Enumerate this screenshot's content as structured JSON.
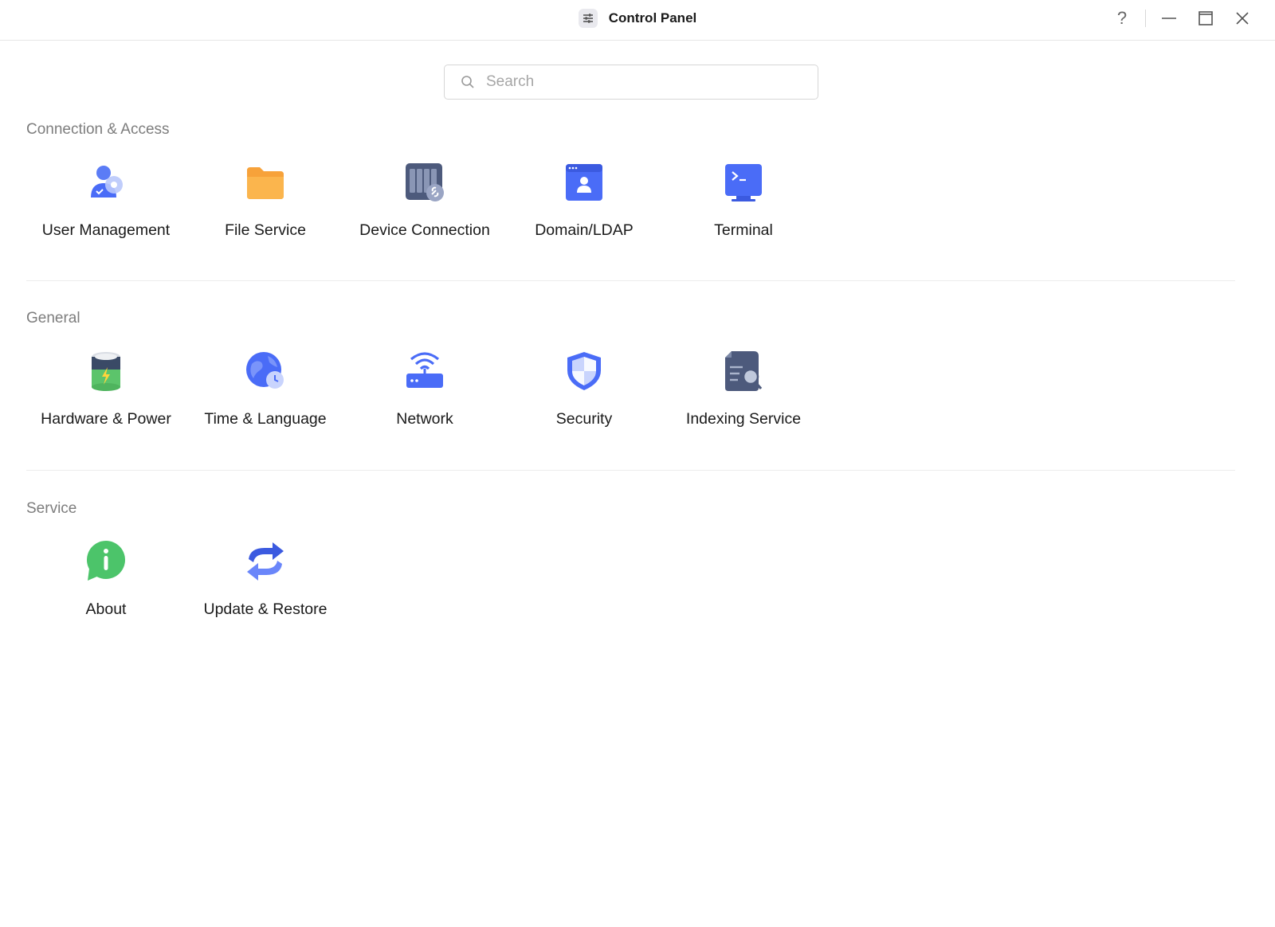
{
  "window": {
    "title": "Control Panel",
    "help_symbol": "?"
  },
  "search": {
    "placeholder": "Search",
    "value": ""
  },
  "sections": [
    {
      "title": "Connection & Access",
      "items": [
        {
          "label": "User Management",
          "icon": "user-management-icon"
        },
        {
          "label": "File Service",
          "icon": "folder-icon"
        },
        {
          "label": "Device Connection",
          "icon": "device-connection-icon"
        },
        {
          "label": "Domain/LDAP",
          "icon": "domain-ldap-icon"
        },
        {
          "label": "Terminal",
          "icon": "terminal-icon"
        }
      ]
    },
    {
      "title": "General",
      "items": [
        {
          "label": "Hardware & Power",
          "icon": "battery-icon"
        },
        {
          "label": "Time & Language",
          "icon": "globe-clock-icon"
        },
        {
          "label": "Network",
          "icon": "router-icon"
        },
        {
          "label": "Security",
          "icon": "shield-icon"
        },
        {
          "label": "Indexing Service",
          "icon": "index-search-icon"
        }
      ]
    },
    {
      "title": "Service",
      "items": [
        {
          "label": "About",
          "icon": "info-icon"
        },
        {
          "label": "Update & Restore",
          "icon": "refresh-icon"
        }
      ]
    }
  ],
  "colors": {
    "accent_blue": "#4a6cf7",
    "folder_orange": "#f7a23a",
    "about_green": "#4cc46a",
    "section_gray": "#7d7d7d"
  }
}
